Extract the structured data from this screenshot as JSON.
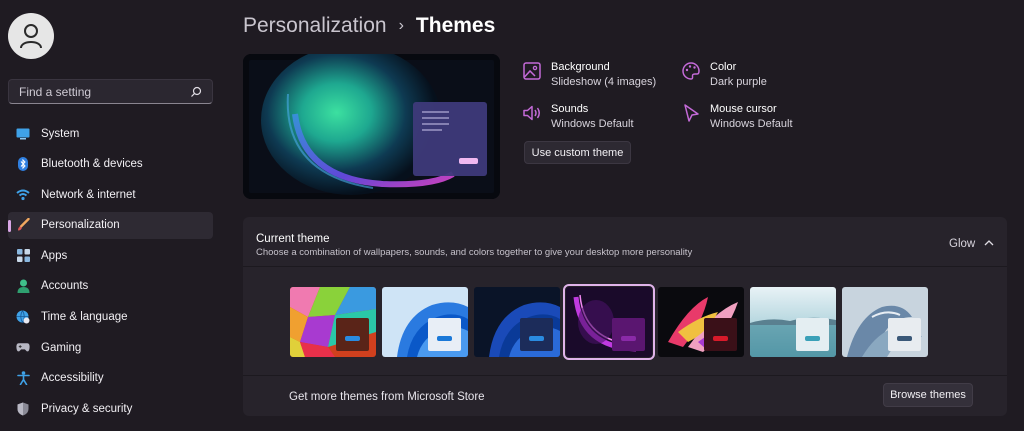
{
  "sidebar": {
    "search_placeholder": "Find a setting",
    "items": [
      {
        "label": "System",
        "icon": "monitor-icon",
        "active": false
      },
      {
        "label": "Bluetooth & devices",
        "icon": "bluetooth-icon",
        "active": false
      },
      {
        "label": "Network & internet",
        "icon": "wifi-icon",
        "active": false
      },
      {
        "label": "Personalization",
        "icon": "brush-icon",
        "active": true
      },
      {
        "label": "Apps",
        "icon": "apps-grid-icon",
        "active": false
      },
      {
        "label": "Accounts",
        "icon": "person-icon",
        "active": false
      },
      {
        "label": "Time & language",
        "icon": "globe-clock-icon",
        "active": false
      },
      {
        "label": "Gaming",
        "icon": "gamepad-icon",
        "active": false
      },
      {
        "label": "Accessibility",
        "icon": "accessibility-icon",
        "active": false
      },
      {
        "label": "Privacy & security",
        "icon": "shield-icon",
        "active": false
      }
    ]
  },
  "header": {
    "parent": "Personalization",
    "separator": "›",
    "current": "Themes"
  },
  "properties": {
    "background": {
      "name": "Background",
      "value": "Slideshow (4 images)"
    },
    "color": {
      "name": "Color",
      "value": "Dark purple"
    },
    "sounds": {
      "name": "Sounds",
      "value": "Windows Default"
    },
    "cursor": {
      "name": "Mouse cursor",
      "value": "Windows Default"
    }
  },
  "custom_theme_button": "Use custom theme",
  "current_theme": {
    "title": "Current theme",
    "description": "Choose a combination of wallpapers, sounds, and colors together to give your desktop more personality",
    "value": "Glow"
  },
  "themes": [
    {
      "name": "colorful-umbrellas",
      "tile_color": "#5a2418",
      "bar_color": "#2a8be0",
      "selected": false
    },
    {
      "name": "windows-light",
      "tile_color": "#e8eef6",
      "bar_color": "#1a78d8",
      "selected": false
    },
    {
      "name": "windows-dark",
      "tile_color": "#1c2c5a",
      "bar_color": "#2a8be0",
      "selected": false
    },
    {
      "name": "glow",
      "tile_color": "#5a1670",
      "bar_color": "#8a2aa8",
      "selected": true
    },
    {
      "name": "captured-motion",
      "tile_color": "#3a1018",
      "bar_color": "#d81a2a",
      "selected": false
    },
    {
      "name": "sunrise-lake",
      "tile_color": "#e4eef2",
      "bar_color": "#3aa0b8",
      "selected": false
    },
    {
      "name": "flow",
      "tile_color": "#e8ecf0",
      "bar_color": "#3a5878",
      "selected": false
    }
  ],
  "footer": {
    "text": "Get more themes from Microsoft Store",
    "button": "Browse themes"
  },
  "colors": {
    "accent": "#d9a6e6",
    "icon_accent": "#c46ad8"
  }
}
